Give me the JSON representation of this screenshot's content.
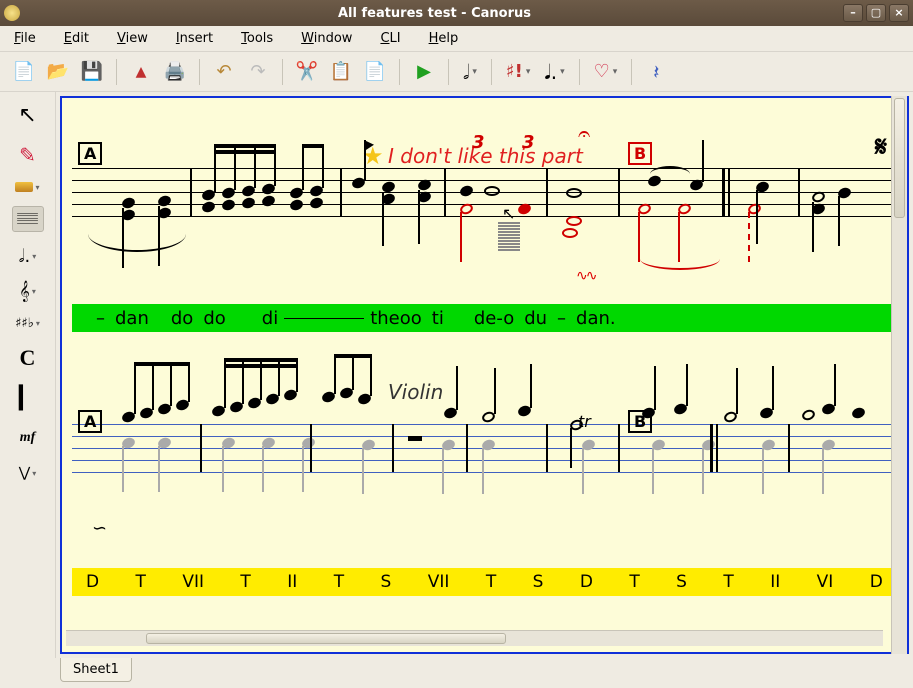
{
  "window": {
    "title": "All features test - Canorus"
  },
  "menus": {
    "file": "File",
    "edit": "Edit",
    "view": "View",
    "insert": "Insert",
    "tools": "Tools",
    "window": "Window",
    "cli": "CLI",
    "help": "Help"
  },
  "toolbar": {
    "new": "new-document-icon",
    "open": "open-folder-icon",
    "save": "save-icon",
    "pdf": "pdf-export-icon",
    "print": "print-icon",
    "undo": "undo-icon",
    "redo": "redo-icon",
    "cut": "cut-icon",
    "copy": "copy-icon",
    "paste": "paste-icon",
    "play": "play-icon",
    "note_dd": "note-duration-dropdown",
    "accidental_dd": "accidental-dropdown",
    "dot_dd": "dot-dropdown",
    "tie_dd": "tie-dropdown",
    "rest": "rest-icon"
  },
  "sidetools": {
    "arrow": "select-tool",
    "insert": "insert-tool",
    "color": "color-tool",
    "staff_mode": "staff-mode-tool",
    "note_dd": "note-picker",
    "clef_dd": "clef-picker",
    "keysig_dd": "key-signature-picker",
    "timesig": "time-signature-tool",
    "barline": "barline-tool",
    "dynamic": "dynamic-mark-tool",
    "hairpin_dd": "hairpin-picker"
  },
  "score": {
    "annotation": "I don't like this part",
    "instrument_label": "Violin",
    "rehearsal_a": "A",
    "rehearsal_b": "B",
    "trill": "tr",
    "tuplet3a": "3",
    "tuplet3b": "3",
    "lyrics1": [
      "–",
      "dan",
      "do",
      "do",
      "di",
      "theoo",
      "ti",
      "de-o",
      "du",
      "–",
      "dan."
    ],
    "lyrics2": [
      "D",
      "T",
      "VII",
      "T",
      "II",
      "T",
      "S",
      "VII",
      "T",
      "S",
      "D",
      "T",
      "S",
      "T",
      "II",
      "VI",
      "D"
    ]
  },
  "tabs": {
    "sheet1": "Sheet1"
  },
  "colors": {
    "canvas_bg": "#fdfcd8",
    "canvas_border": "#1030d8",
    "lyrics_green": "#00d800",
    "lyrics_yellow": "#ffec00",
    "annotation_red": "#e02020",
    "note_red": "#d00000"
  }
}
